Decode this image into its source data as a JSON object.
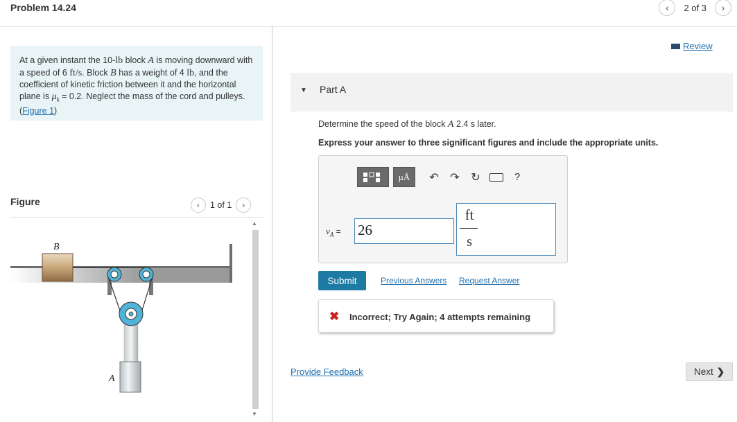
{
  "header": {
    "title": "Problem 14.24",
    "page_indicator": "2 of 3",
    "prev_icon": "chevron-left-icon",
    "next_icon": "chevron-right-icon"
  },
  "problem": {
    "p1": "At a given instant the 10-",
    "lb1": "lb",
    "p2": " block ",
    "A": "A",
    "p3": " is moving downward with a speed of 6 ",
    "unit_fts": "ft/s",
    "p4": ". Block ",
    "B": "B",
    "p5": " has a weight of 4 ",
    "lb2": "lb",
    "p6": ", and the coefficient of kinetic friction between it and the horizontal plane is ",
    "mu": "μ",
    "mu_sub": "k",
    "p7": " = 0.2. Neglect the mass of the cord and pulleys. (",
    "figure_link": "Figure 1",
    "p8": ")"
  },
  "figure": {
    "label": "Figure",
    "page_indicator": "1 of 1",
    "block_b_label": "B",
    "block_a_label": "A"
  },
  "review": {
    "label": "Review"
  },
  "part": {
    "label": "Part A"
  },
  "question": {
    "text_before": "Determine the speed of the block ",
    "var": "A",
    "text_after": " 2.4  s later.",
    "instruction": "Express your answer to three significant figures and include the appropriate units."
  },
  "toolbar": {
    "mu_button": "μÅ",
    "help": "?"
  },
  "answer": {
    "var_name": "v",
    "var_sub": "A",
    "equals": " =",
    "value": "26",
    "unit_numerator": "ft",
    "unit_denominator": "s"
  },
  "actions": {
    "submit": "Submit",
    "previous_answers": "Previous Answers",
    "request_answer": "Request Answer"
  },
  "feedback": {
    "message": "Incorrect; Try Again; 4 attempts remaining"
  },
  "footer": {
    "provide_feedback": "Provide Feedback",
    "next": "Next"
  },
  "colors": {
    "accent": "#1c7aa3",
    "link": "#1f6fae",
    "error": "#cc1f1f",
    "problem_bg": "#e8f4f6"
  }
}
